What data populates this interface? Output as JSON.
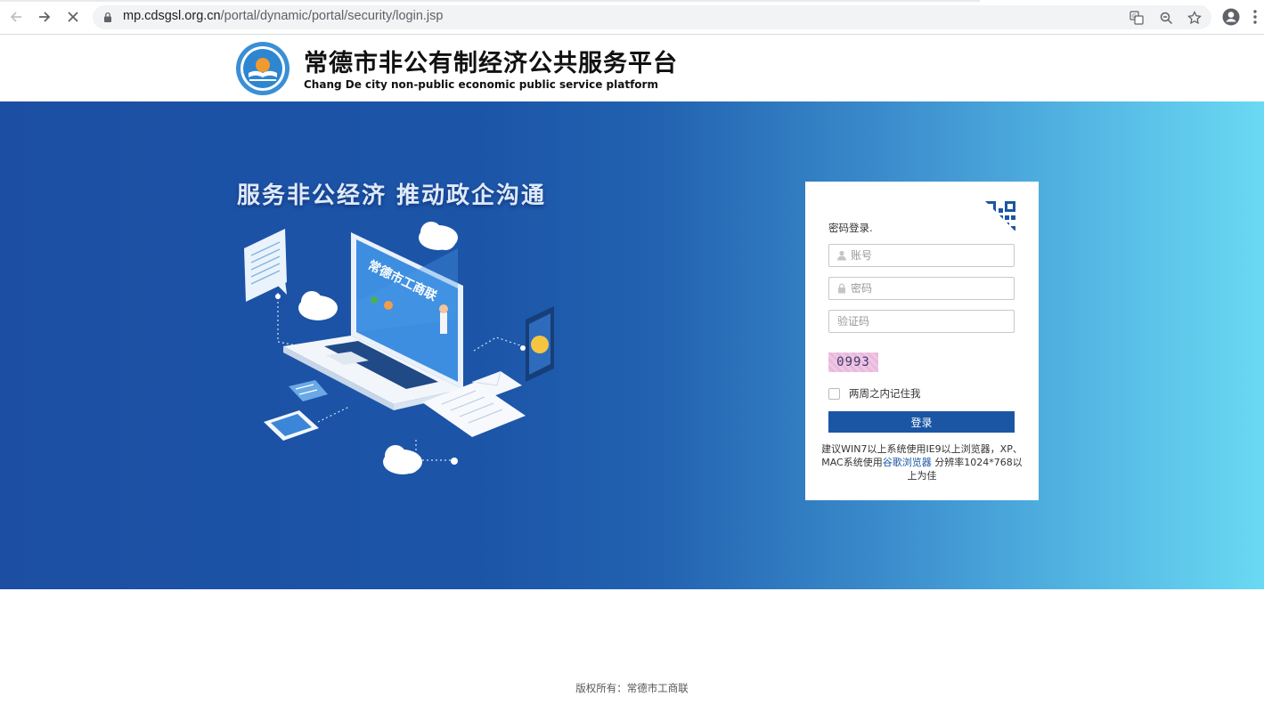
{
  "browser": {
    "url_domain": "mp.cdsgsl.org.cn",
    "url_path": "/portal/dynamic/portal/security/login.jsp"
  },
  "header": {
    "title": "常德市非公有制经济公共服务平台",
    "subtitle": "Chang De city non-public economic public service platform"
  },
  "banner": {
    "slogan": "服务非公经济  推动政企沟通",
    "screen_text": "常德市工商联"
  },
  "login": {
    "tab_label": "密码登录.",
    "account_placeholder": "账号",
    "password_placeholder": "密码",
    "captcha_placeholder": "验证码",
    "captcha_text": "0993",
    "remember_label": "两周之内记住我",
    "submit_label": "登录",
    "tip_part1": "建议WIN7以上系统使用IE9以上浏览器，XP、MAC系统使用",
    "tip_link": "谷歌浏览器",
    "tip_part2": " 分辨率1024*768以上为佳"
  },
  "footer": {
    "copyright": "版权所有：常德市工商联"
  },
  "colors": {
    "primary": "#1a56a4",
    "banner_start": "#1c4fa3",
    "banner_end": "#6ad9f3"
  }
}
